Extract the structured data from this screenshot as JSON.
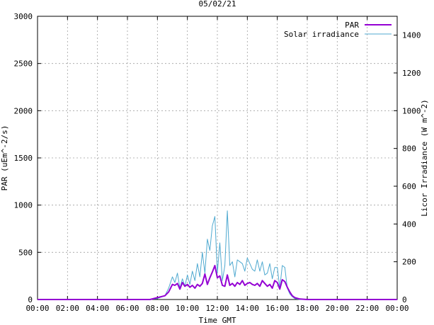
{
  "chart_data": {
    "type": "line",
    "title": "05/02/21",
    "xlabel": "Time GMT",
    "ylabel": "PAR (uEm^-2/s)",
    "y2label": "Licor Irradiance (W m^-2)",
    "xlim": [
      "00:00",
      "24:00"
    ],
    "ylim": [
      0,
      3000
    ],
    "y2lim": [
      0,
      1500
    ],
    "grid": true,
    "legend_position": "top-right",
    "x_ticks": [
      "00:00",
      "02:00",
      "04:00",
      "06:00",
      "08:00",
      "10:00",
      "12:00",
      "14:00",
      "16:00",
      "18:00",
      "20:00",
      "22:00",
      "00:00"
    ],
    "y_ticks": [
      "0",
      "500",
      "1000",
      "1500",
      "2000",
      "2500",
      "3000"
    ],
    "y2_ticks": [
      "0",
      "200",
      "400",
      "600",
      "800",
      "1000",
      "1200",
      "1400"
    ],
    "series": [
      {
        "name": "PAR",
        "color": "#9400d3",
        "axis": "left",
        "x": [
          "00:00",
          "07:30",
          "08:00",
          "08:30",
          "08:45",
          "09:00",
          "09:10",
          "09:20",
          "09:30",
          "09:40",
          "09:50",
          "10:00",
          "10:10",
          "10:20",
          "10:30",
          "10:40",
          "10:50",
          "11:00",
          "11:10",
          "11:20",
          "11:30",
          "11:40",
          "11:50",
          "12:00",
          "12:10",
          "12:20",
          "12:30",
          "12:40",
          "12:50",
          "13:00",
          "13:10",
          "13:20",
          "13:30",
          "13:40",
          "13:50",
          "14:00",
          "14:10",
          "14:20",
          "14:30",
          "14:40",
          "14:50",
          "15:00",
          "15:10",
          "15:20",
          "15:30",
          "15:40",
          "15:50",
          "16:00",
          "16:10",
          "16:20",
          "16:30",
          "16:40",
          "16:50",
          "17:00",
          "17:10",
          "17:30",
          "18:00",
          "24:00"
        ],
        "values": [
          0,
          0,
          20,
          40,
          80,
          160,
          150,
          170,
          110,
          180,
          140,
          160,
          130,
          150,
          120,
          160,
          140,
          170,
          270,
          160,
          230,
          290,
          360,
          230,
          250,
          150,
          140,
          260,
          150,
          170,
          140,
          180,
          160,
          200,
          150,
          170,
          180,
          160,
          150,
          170,
          140,
          200,
          170,
          140,
          160,
          120,
          200,
          180,
          110,
          210,
          190,
          130,
          80,
          40,
          20,
          5,
          0,
          0
        ]
      },
      {
        "name": "Solar irradiance",
        "color": "#4fa9d0",
        "axis": "right",
        "x": [
          "00:00",
          "07:30",
          "08:00",
          "08:30",
          "08:45",
          "09:00",
          "09:10",
          "09:20",
          "09:30",
          "09:40",
          "09:50",
          "10:00",
          "10:10",
          "10:20",
          "10:30",
          "10:40",
          "10:50",
          "11:00",
          "11:10",
          "11:20",
          "11:30",
          "11:40",
          "11:50",
          "12:00",
          "12:10",
          "12:20",
          "12:30",
          "12:40",
          "12:50",
          "13:00",
          "13:10",
          "13:20",
          "13:30",
          "13:40",
          "13:50",
          "14:00",
          "14:10",
          "14:20",
          "14:30",
          "14:40",
          "14:50",
          "15:00",
          "15:10",
          "15:20",
          "15:30",
          "15:40",
          "15:50",
          "16:00",
          "16:10",
          "16:20",
          "16:30",
          "16:40",
          "16:50",
          "17:00",
          "17:10",
          "17:30",
          "18:00",
          "24:00"
        ],
        "values": [
          0,
          0,
          5,
          20,
          60,
          120,
          90,
          140,
          60,
          110,
          70,
          130,
          80,
          150,
          100,
          190,
          120,
          250,
          140,
          320,
          260,
          390,
          440,
          140,
          300,
          100,
          180,
          470,
          180,
          200,
          120,
          210,
          200,
          190,
          150,
          220,
          190,
          160,
          150,
          210,
          150,
          200,
          130,
          140,
          190,
          110,
          170,
          170,
          60,
          180,
          170,
          60,
          30,
          15,
          5,
          0,
          0,
          0
        ]
      }
    ]
  }
}
